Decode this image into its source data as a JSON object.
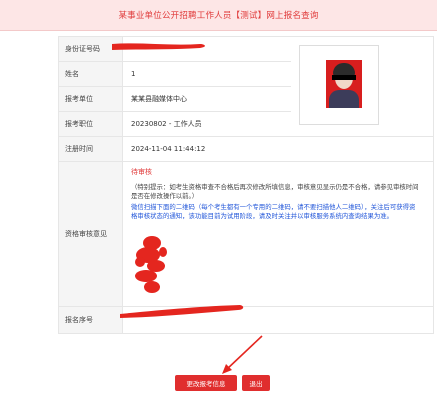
{
  "header": {
    "title": "某事业单位公开招聘工作人员【测试】网上报名查询"
  },
  "rows": {
    "id_number": {
      "label": "身份证号码",
      "value": ""
    },
    "name": {
      "label": "姓名",
      "value": "1"
    },
    "unit": {
      "label": "报考单位",
      "value": "某某县融媒体中心"
    },
    "position": {
      "label": "报考职位",
      "value": "20230802 - 工作人员"
    },
    "register_time": {
      "label": "注册时间",
      "value": "2024-11-04 11:44:12"
    },
    "review": {
      "label": "资格审核意见",
      "status": "待审核",
      "tip": "（特别提示：如考生资格审查不合格后再次修改所填信息，审核意见显示仍是不合格，请参见审核时间是否在修改操作以前。）",
      "wechat_notice": "微信扫描下面的二维码（每个考生都有一个专用的二维码，请不要扫描他人二维码），关注后可获得资格审核状态的通知，该功能目前为试用阶段，请及时关注并以审核服务系统内查询结果为准。"
    },
    "reg_number": {
      "label": "报名序号",
      "value": ""
    }
  },
  "buttons": {
    "modify": "更改报考信息",
    "exit": "退出"
  },
  "colors": {
    "accent": "#e02e2e",
    "header_bg": "#fde6e6",
    "notice_blue": "#2156d9"
  }
}
